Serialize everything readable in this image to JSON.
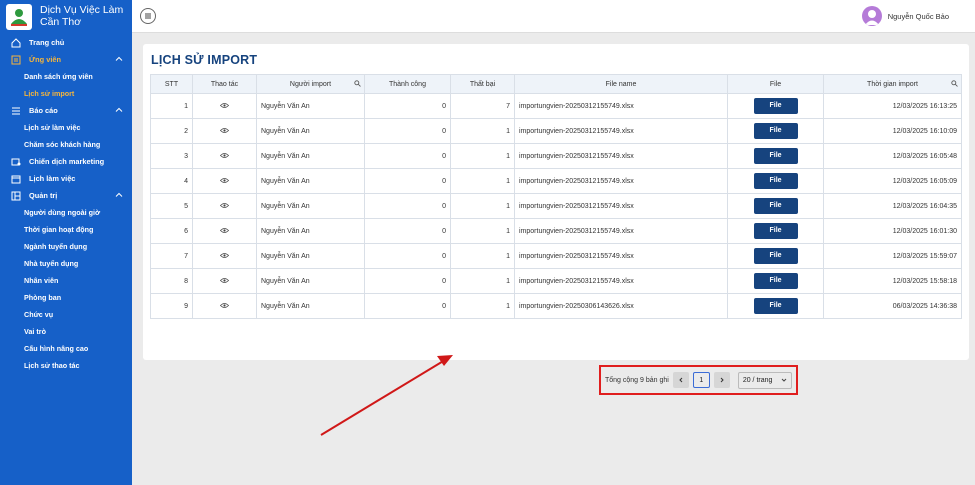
{
  "brand": {
    "title": "Dịch Vụ Việc Làm Cần Thơ"
  },
  "sidebar": {
    "items": [
      {
        "label": "Trang chủ",
        "icon": "home-icon"
      },
      {
        "label": "Ứng viên",
        "icon": "user-form-icon"
      },
      {
        "label": "Danh sách ứng viên"
      },
      {
        "label": "Lịch sử import"
      },
      {
        "label": "Báo cáo",
        "icon": "list-icon"
      },
      {
        "label": "Lịch sử làm việc"
      },
      {
        "label": "Chăm sóc khách hàng"
      },
      {
        "label": "Chiến dịch marketing",
        "icon": "marketing-icon"
      },
      {
        "label": "Lịch làm việc",
        "icon": "calendar-icon"
      },
      {
        "label": "Quản trị",
        "icon": "admin-icon"
      },
      {
        "label": "Người dùng ngoài giờ"
      },
      {
        "label": "Thời gian hoạt động"
      },
      {
        "label": "Ngành tuyển dụng"
      },
      {
        "label": "Nhà tuyển dụng"
      },
      {
        "label": "Nhân viên"
      },
      {
        "label": "Phòng ban"
      },
      {
        "label": "Chức vụ"
      },
      {
        "label": "Vai trò"
      },
      {
        "label": "Cấu hình nâng cao"
      },
      {
        "label": "Lịch sử thao tác"
      }
    ]
  },
  "user": {
    "name": "Nguyễn Quốc Bảo"
  },
  "page": {
    "title": "LỊCH SỬ IMPORT"
  },
  "table": {
    "headers": [
      "STT",
      "Thao tác",
      "Người import",
      "Thành công",
      "Thất bại",
      "File name",
      "File",
      "Thời gian import"
    ],
    "rows": [
      {
        "stt": "1",
        "user": "Nguyễn Văn An",
        "ok": "0",
        "fail": "7",
        "file": "importungvien-20250312155749.xlsx",
        "btn": "File",
        "time": "12/03/2025 16:13:25"
      },
      {
        "stt": "2",
        "user": "Nguyễn Văn An",
        "ok": "0",
        "fail": "1",
        "file": "importungvien-20250312155749.xlsx",
        "btn": "File",
        "time": "12/03/2025 16:10:09"
      },
      {
        "stt": "3",
        "user": "Nguyễn Văn An",
        "ok": "0",
        "fail": "1",
        "file": "importungvien-20250312155749.xlsx",
        "btn": "File",
        "time": "12/03/2025 16:05:48"
      },
      {
        "stt": "4",
        "user": "Nguyễn Văn An",
        "ok": "0",
        "fail": "1",
        "file": "importungvien-20250312155749.xlsx",
        "btn": "File",
        "time": "12/03/2025 16:05:09"
      },
      {
        "stt": "5",
        "user": "Nguyễn Văn An",
        "ok": "0",
        "fail": "1",
        "file": "importungvien-20250312155749.xlsx",
        "btn": "File",
        "time": "12/03/2025 16:04:35"
      },
      {
        "stt": "6",
        "user": "Nguyễn Văn An",
        "ok": "0",
        "fail": "1",
        "file": "importungvien-20250312155749.xlsx",
        "btn": "File",
        "time": "12/03/2025 16:01:30"
      },
      {
        "stt": "7",
        "user": "Nguyễn Văn An",
        "ok": "0",
        "fail": "1",
        "file": "importungvien-20250312155749.xlsx",
        "btn": "File",
        "time": "12/03/2025 15:59:07"
      },
      {
        "stt": "8",
        "user": "Nguyễn Văn An",
        "ok": "0",
        "fail": "1",
        "file": "importungvien-20250312155749.xlsx",
        "btn": "File",
        "time": "12/03/2025 15:58:18"
      },
      {
        "stt": "9",
        "user": "Nguyễn Văn An",
        "ok": "0",
        "fail": "1",
        "file": "importungvien-20250306143626.xlsx",
        "btn": "File",
        "time": "06/03/2025 14:36:38"
      }
    ]
  },
  "pagination": {
    "total_text": "Tổng cộng 9 bản ghi",
    "current_page": "1",
    "page_size": "20 / trang"
  },
  "colors": {
    "sidebar": "#1660c8",
    "accent": "#f5b53c",
    "title": "#16437e",
    "highlight": "#e01e1e"
  }
}
